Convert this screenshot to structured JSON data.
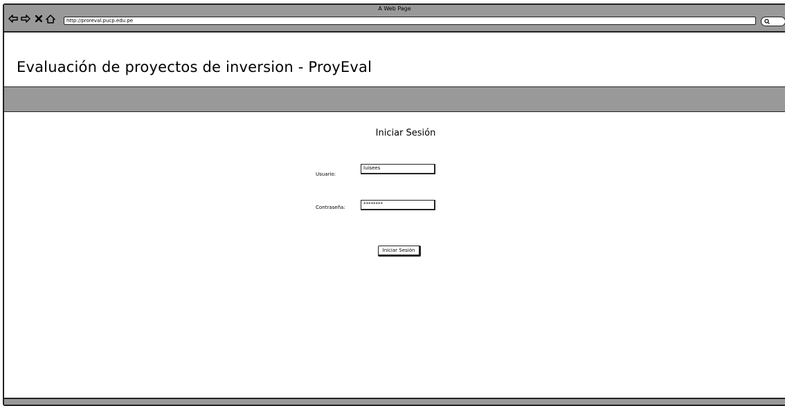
{
  "window": {
    "title": "A Web Page"
  },
  "browser": {
    "url": "http://proreval.pucp.edu.pe",
    "icons": [
      "back-arrow-icon",
      "forward-arrow-icon",
      "close-x-icon",
      "home-icon",
      "search-icon"
    ]
  },
  "header": {
    "title": "Evaluación de proyectos de inversion - ProyEval"
  },
  "login": {
    "heading": "Iniciar Sesión",
    "username_label": "Usuario:",
    "username_value": "luisees",
    "password_label": "Contraseña:",
    "password_value": "********",
    "submit_label": "Iniciar Sesión"
  },
  "colors": {
    "bar_gray": "#999999",
    "border": "#222222",
    "background": "#ffffff"
  }
}
